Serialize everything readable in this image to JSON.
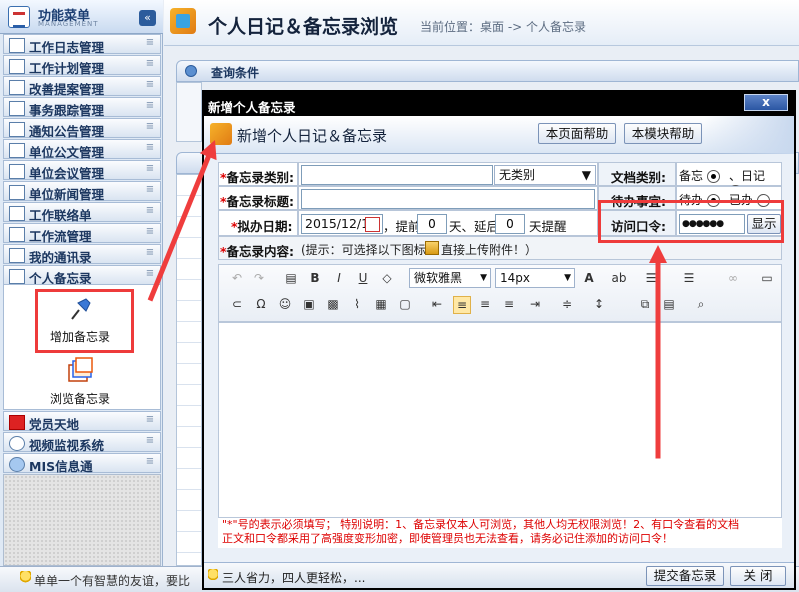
{
  "sidebar": {
    "title": "功能菜单",
    "subtitle": "MANAGEMENT",
    "collapse_icon": "«",
    "items": [
      {
        "label": "工作日志管理",
        "icon": "calendar-icon"
      },
      {
        "label": "工作计划管理",
        "icon": "notepad-icon"
      },
      {
        "label": "改善提案管理",
        "icon": "users-icon"
      },
      {
        "label": "事务跟踪管理",
        "icon": "window-icon"
      },
      {
        "label": "通知公告管理",
        "icon": "board-icon"
      },
      {
        "label": "单位公文管理",
        "icon": "document-icon"
      },
      {
        "label": "单位会议管理",
        "icon": "meeting-icon"
      },
      {
        "label": "单位新闻管理",
        "icon": "news-icon"
      },
      {
        "label": "工作联络单",
        "icon": "contact-icon"
      },
      {
        "label": "工作流管理",
        "icon": "flow-icon"
      },
      {
        "label": "我的通讯录",
        "icon": "addressbook-icon"
      },
      {
        "label": "个人备忘录",
        "icon": "memo-icon"
      }
    ],
    "sub_items": [
      {
        "label": "增加备忘录",
        "icon": "pushpin-icon"
      },
      {
        "label": "浏览备忘录",
        "icon": "stack-icon"
      }
    ],
    "bottom_items": [
      {
        "label": "党员天地",
        "icon": "party-icon"
      },
      {
        "label": "视频监视系统",
        "icon": "camera-icon"
      },
      {
        "label": "MIS信息通",
        "icon": "info-icon"
      }
    ],
    "tip": "单单一个有智慧的友谊，要比"
  },
  "main": {
    "title": "个人日记＆备忘录浏览",
    "breadcrumb": "当前位置：桌面 -> 个人备忘录",
    "query_panel": "查询条件"
  },
  "dialog": {
    "window_title": "新增个人备忘录",
    "close_label": "x",
    "heading": "新增个人日记＆备忘录",
    "help_page": "本页面帮助",
    "help_module": "本模块帮助",
    "fields": {
      "category_label": "备忘录类别:",
      "category_value": "",
      "category_select": "无类别",
      "doc_type_label": "文档类别:",
      "doc_type_opt1": "备忘",
      "doc_type_opt2": "、日记",
      "title_label": "备忘录标题:",
      "title_value": "",
      "todo_label": "待办事宜:",
      "todo_opt1": "待办",
      "todo_opt2": "已办",
      "date_label": "拟办日期:",
      "date_value": "2015/12/17",
      "before_text": "，提前",
      "before_value": "0",
      "after_text": "天、延后",
      "after_value": "0",
      "remind_text": "天提醒",
      "password_label": "访问口令:",
      "password_value": "●●●●●●",
      "show_button": "显示",
      "content_label": "备忘录内容:",
      "content_hint": "(提示：可选择以下图标",
      "content_hint2": "直接上传附件！）"
    },
    "editor": {
      "font_select": "微软雅黑",
      "size_select": "14px"
    },
    "notes_line1": "\"*\"号的表示必须填写；  特别说明：1、备忘录仅本人可浏览，其他人均无权限浏览！2、有口令查看的文档",
    "notes_line2": "正文和口令都采用了高强度变形加密，即使管理员也无法查看，请务必记住添加的访问口令！",
    "footer_tip": "三人省力，四人更轻松，...",
    "submit_button": "提交备忘录",
    "close_button": "关 闭"
  },
  "colors": {
    "annotation": "#ee3b3b",
    "title_bar": "#000000",
    "required": "#dd0000"
  }
}
